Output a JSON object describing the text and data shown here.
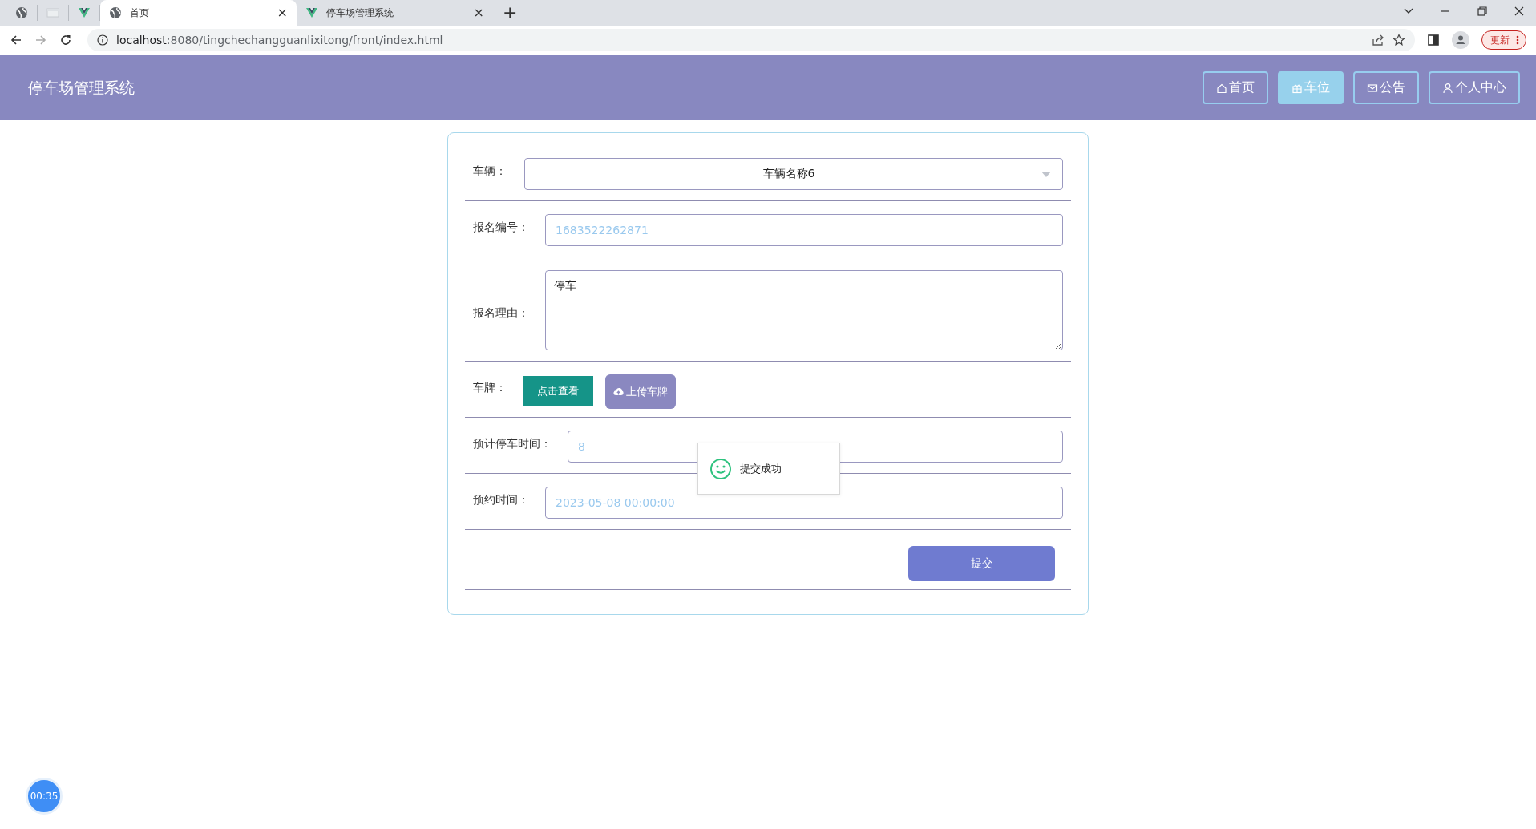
{
  "browser": {
    "tabs": [
      {
        "kind": "pinned",
        "selected": false
      },
      {
        "kind": "pinned",
        "selected": false
      },
      {
        "kind": "pinned",
        "selected": false
      },
      {
        "kind": "full",
        "title": "首页",
        "close": "×",
        "selected": true
      },
      {
        "kind": "full",
        "title": "停车场管理系统",
        "close": "×",
        "selected": false
      }
    ],
    "new_tab": "+",
    "url_host": "localhost",
    "url_rest": ":8080/tingchechangguanlixitong/front/index.html",
    "update_button": "更新"
  },
  "header": {
    "title": "停车场管理系统",
    "nav": [
      {
        "label": "首页",
        "selected": false
      },
      {
        "label": "车位",
        "selected": true
      },
      {
        "label": "公告",
        "selected": false
      },
      {
        "label": "个人中心",
        "selected": false
      }
    ]
  },
  "form": {
    "rows": [
      {
        "kind": "select",
        "label": "车辆：",
        "value": "车辆名称6"
      },
      {
        "kind": "input",
        "label": "报名编号：",
        "value": "1683522262871",
        "readonly": true
      },
      {
        "kind": "textarea",
        "label": "报名理由：",
        "value": "停车",
        "readonly": false
      },
      {
        "kind": "buttons",
        "label": "车牌：",
        "buttons": [
          {
            "label": "点击查看",
            "kind": "view"
          },
          {
            "label": "上传车牌",
            "kind": "upload"
          }
        ]
      },
      {
        "kind": "input",
        "label": "预计停车时间：",
        "value": "8",
        "readonly": true
      },
      {
        "kind": "input",
        "label": "预约时间：",
        "value": "2023-05-08 00:00:00",
        "readonly": true
      }
    ],
    "submit": "提交"
  },
  "toast": {
    "message": "提交成功"
  },
  "timer": "00:35"
}
